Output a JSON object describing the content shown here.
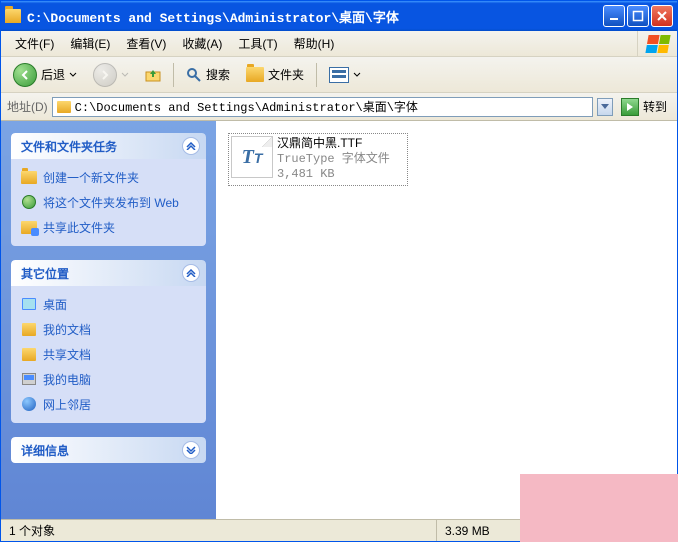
{
  "window": {
    "title": "C:\\Documents and Settings\\Administrator\\桌面\\字体"
  },
  "menu": {
    "file": "文件(F)",
    "edit": "编辑(E)",
    "view": "查看(V)",
    "fav": "收藏(A)",
    "tools": "工具(T)",
    "help": "帮助(H)"
  },
  "toolbar": {
    "back": "后退",
    "search": "搜索",
    "folders": "文件夹"
  },
  "address": {
    "label": "地址(D)",
    "value": "C:\\Documents and Settings\\Administrator\\桌面\\字体",
    "go": "转到"
  },
  "panels": {
    "tasks": {
      "title": "文件和文件夹任务",
      "items": {
        "new_folder": "创建一个新文件夹",
        "publish_web": "将这个文件夹发布到 Web",
        "share": "共享此文件夹"
      }
    },
    "places": {
      "title": "其它位置",
      "items": {
        "desktop": "桌面",
        "my_docs": "我的文档",
        "shared_docs": "共享文档",
        "my_computer": "我的电脑",
        "network": "网上邻居"
      }
    },
    "details": {
      "title": "详细信息"
    }
  },
  "file": {
    "name": "汉鼎简中黑.TTF",
    "type": "TrueType 字体文件",
    "size": "3,481 KB"
  },
  "status": {
    "count": "1 个对象",
    "total_size": "3.39 MB"
  }
}
